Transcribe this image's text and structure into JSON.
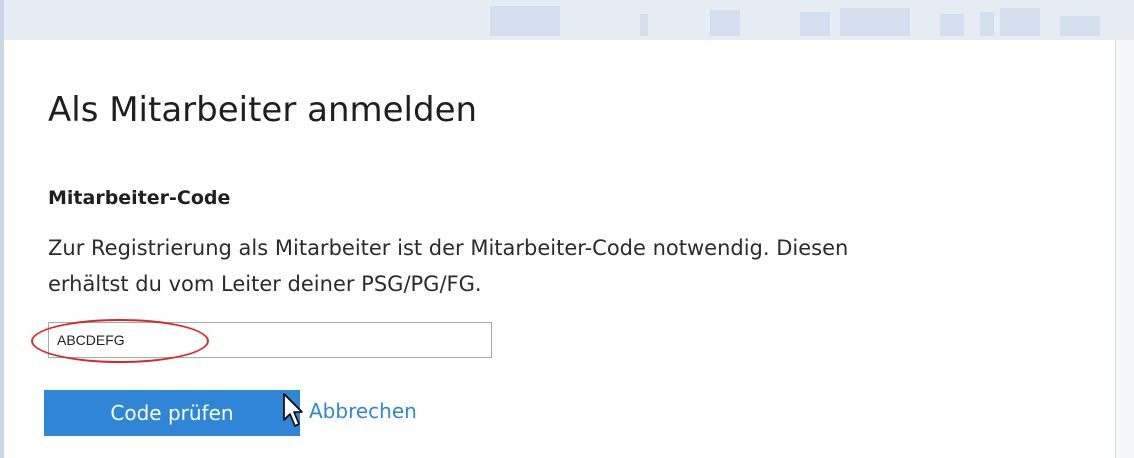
{
  "dialog": {
    "title": "Als Mitarbeiter anmelden",
    "section_label": "Mitarbeiter-Code",
    "description_line1": "Zur Registrierung als Mitarbeiter ist der Mitarbeiter-Code notwendig. Diesen",
    "description_line2": "erhältst du vom Leiter deiner PSG/PG/FG.",
    "code_input": {
      "value": "ABCDEFG",
      "placeholder": ""
    },
    "check_button_label": "Code prüfen",
    "cancel_link_label": "Abbrechen"
  },
  "colors": {
    "accent": "#2f86d6",
    "highlight": "#d42a2a",
    "banner": "#e6edf5"
  },
  "icons": {
    "cursor": "mouse-pointer-icon"
  }
}
